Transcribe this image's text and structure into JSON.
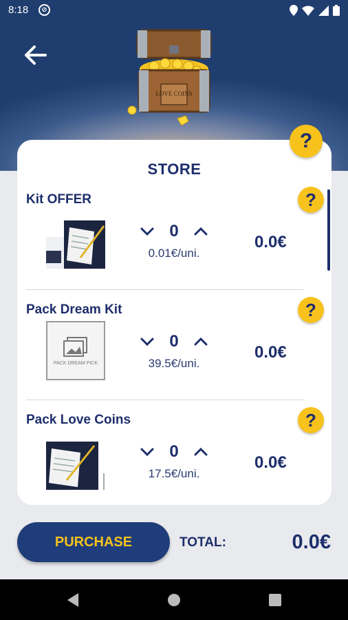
{
  "status": {
    "time": "8:18"
  },
  "header": {
    "chest_text": "LOVE COINS"
  },
  "store": {
    "title": "STORE"
  },
  "items": [
    {
      "name": "Kit OFFER",
      "qty": "0",
      "unit": "0.01€/uni.",
      "price": "0.0€"
    },
    {
      "name": "Pack Dream Kit",
      "qty": "0",
      "unit": "39.5€/uni.",
      "price": "0.0€",
      "thumb_text": "PACK DREAM PICK"
    },
    {
      "name": "Pack Love Coins",
      "qty": "0",
      "unit": "17.5€/uni.",
      "price": "0.0€"
    }
  ],
  "footer": {
    "purchase_label": "PURCHASE",
    "total_label": "TOTAL:",
    "total_value": "0.0€"
  },
  "colors": {
    "navy": "#1d2e6b",
    "accent": "#f7c21c",
    "button": "#1f3d7a"
  }
}
